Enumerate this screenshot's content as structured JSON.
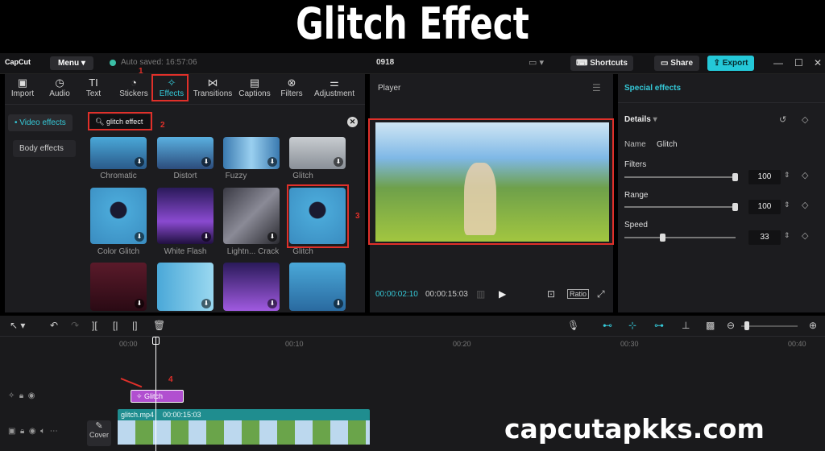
{
  "page_title": "Glitch Effect",
  "watermark": "capcutapkks.com",
  "topbar": {
    "logo": "CapCut",
    "menu_label": "Menu",
    "autosave": "Auto saved: 16:57:06",
    "project_name": "0918",
    "shortcuts_label": "Shortcuts",
    "share_label": "Share",
    "export_label": "Export"
  },
  "toolbar": [
    {
      "label": "Import",
      "icon": "import-icon"
    },
    {
      "label": "Audio",
      "icon": "audio-icon"
    },
    {
      "label": "Text",
      "icon": "text-icon"
    },
    {
      "label": "Stickers",
      "icon": "stickers-icon"
    },
    {
      "label": "Effects",
      "icon": "effects-icon"
    },
    {
      "label": "Transitions",
      "icon": "transitions-icon"
    },
    {
      "label": "Captions",
      "icon": "captions-icon"
    },
    {
      "label": "Filters",
      "icon": "filters-icon"
    },
    {
      "label": "Adjustment",
      "icon": "adjustment-icon"
    }
  ],
  "side_tabs": [
    "Video effects",
    "Body effects"
  ],
  "search": {
    "value": "glitch effect"
  },
  "effects": [
    {
      "label": "Chromatic"
    },
    {
      "label": "Distort"
    },
    {
      "label": "Fuzzy"
    },
    {
      "label": "Glitch"
    },
    {
      "label": "Color Glitch"
    },
    {
      "label": "White Flash"
    },
    {
      "label": "Lightn... Crack"
    },
    {
      "label": "Glitch"
    }
  ],
  "player": {
    "title": "Player",
    "current_time": "00:00:02:10",
    "total_time": "00:00:15:03",
    "ratio_label": "Ratio"
  },
  "special": {
    "title": "Special effects",
    "details_label": "Details",
    "name_label": "Name",
    "name_value": "Glitch",
    "params": [
      {
        "label": "Filters",
        "value": "100",
        "fraction": 1.0
      },
      {
        "label": "Range",
        "value": "100",
        "fraction": 1.0
      },
      {
        "label": "Speed",
        "value": "33",
        "fraction": 0.33
      }
    ]
  },
  "timeline": {
    "ruler": [
      "00:00",
      "00:10",
      "00:20",
      "00:30",
      "00:40"
    ],
    "effect_clip_label": "Glitch",
    "video_clip_name": "glitch.mp4",
    "video_clip_duration": "00:00:15:03",
    "cover_label": "Cover"
  },
  "annotations": [
    "1",
    "2",
    "3",
    "4"
  ],
  "colors": {
    "accent": "#35c9d8",
    "annotation": "#e0302a",
    "effect_clip": "#b14fd0",
    "video_clip": "#1f8d8f"
  }
}
